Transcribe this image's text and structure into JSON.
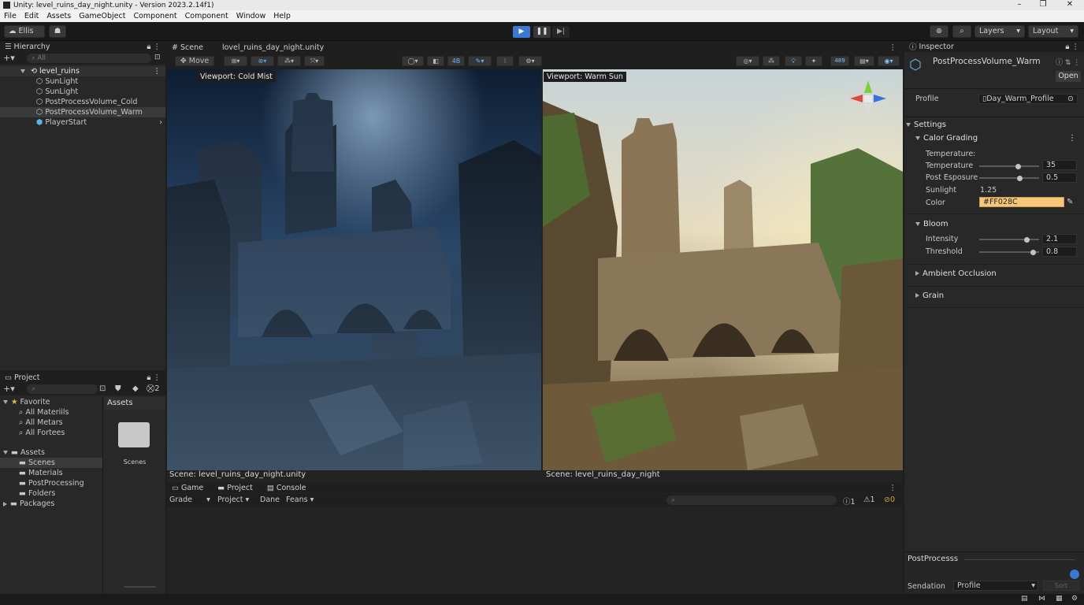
{
  "window": {
    "title": "Unity: level_ruins_day_night.unity - Version 2023.2.14f1)",
    "minimize": "–",
    "restore": "❐",
    "close": "✕"
  },
  "menu": [
    "File",
    "Edit",
    "Assets",
    "GameObject",
    "Component",
    "Component",
    "Window",
    "Help"
  ],
  "toolbar": {
    "account": "Ellis",
    "layers": "Layers",
    "layout": "Layout"
  },
  "hierarchy": {
    "tab": "Hierarchy",
    "search_placeholder": "All",
    "scene": "level_ruins",
    "items": [
      "SunLight",
      "SunLight",
      "PostProcessVolume_Cold",
      "PostProcessVolume_Warm",
      "PlayerStart"
    ]
  },
  "scene": {
    "tab": "Scene",
    "file_tab": "lovel_ruins_day_night.unity",
    "move_label": "Move",
    "stat_2d": "4B",
    "stat_count": "489",
    "left_viewport_label": "Viewport: Cold Mist",
    "right_viewport_label": "Viewport: Warm Sun",
    "left_caption": "Scene: level_ruins_day_night.unity",
    "right_caption": "Scene: level_ruins_day_night"
  },
  "project": {
    "tab": "Project",
    "count": "2",
    "favorite": "Favorite",
    "favorites": [
      "All Materiils",
      "All Metars",
      "All Fortees"
    ],
    "assets": "Assets",
    "asset_children": [
      "Scenes",
      "Materials",
      "PostProcessing",
      "Folders"
    ],
    "packages": "Packages",
    "assets_header": "Assets",
    "folder_label": "Scenes"
  },
  "console": {
    "tabs": [
      "Game",
      "Project",
      "Console"
    ],
    "filters": [
      "Grade",
      "Project",
      "Dane",
      "Feans"
    ],
    "count_a": "1",
    "count_b": "1",
    "count_c": "0"
  },
  "inspector": {
    "tab": "Inspector",
    "object_name": "PostProcessVolume_Warm",
    "open_button": "Open",
    "profile_label": "Profile",
    "profile_value": "Day_Warm_Profile",
    "settings": "Settings",
    "color_grading": "Calor Grading",
    "temperature_header": "Temperature:",
    "temperature_label": "Temperature",
    "temperature_value": "35",
    "temperature_level": 0.65,
    "exposure_label": "Post Esposure",
    "exposure_value": "0.5",
    "exposure_level": 0.68,
    "sunlight_label": "Sunlight",
    "sunlight_value": "1.25",
    "color_label": "Color",
    "color_value": "#FF028C",
    "color_swatch": "#f6c67a",
    "bloom": "Bloom",
    "intensity_label": "Intensity",
    "intensity_value": "2.1",
    "intensity_level": 0.8,
    "threshold_label": "Threshold",
    "threshold_value": "0.8",
    "threshold_level": 0.9,
    "ambient_occlusion": "Ambient Occlusion",
    "grain": "Grain",
    "footer_title": "PostProcesss",
    "footer_row_label": "Sendation",
    "footer_dropdown": "Profile",
    "footer_button": "Sort"
  },
  "colors": {
    "play_accent": "#3a78d2",
    "editor_bg": "#282828",
    "highlight_field": "#f6c67a"
  }
}
